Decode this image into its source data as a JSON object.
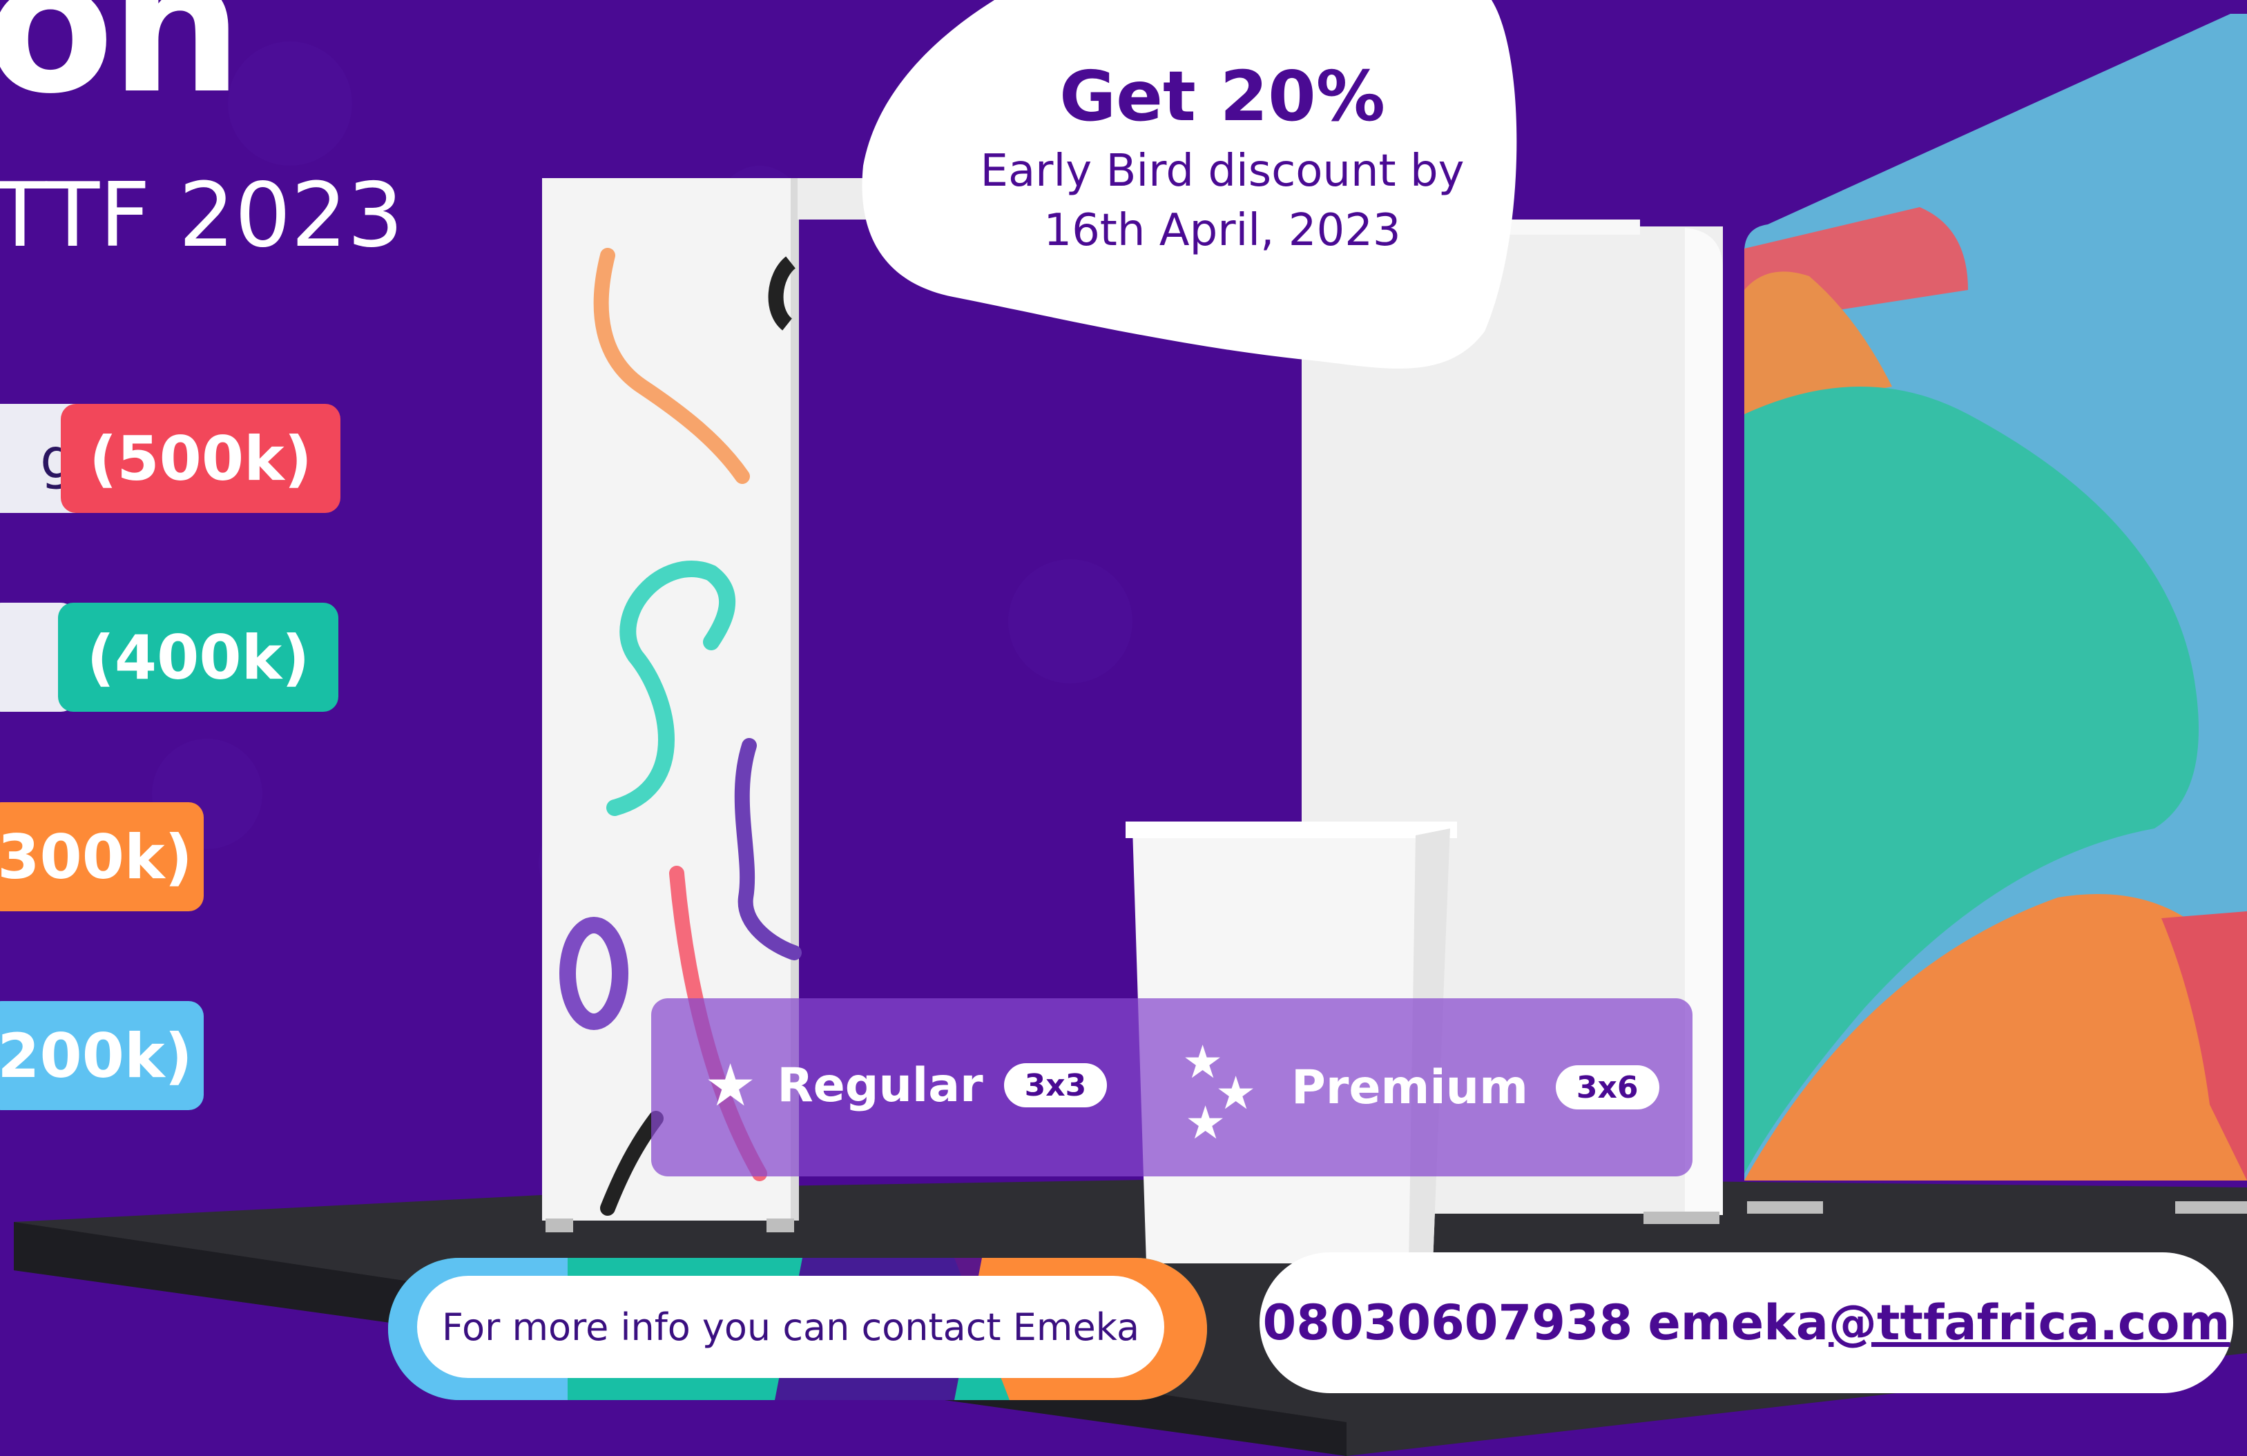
{
  "headline_fragment": "on",
  "subtitle": "TTF 2023",
  "pricing": {
    "prefix_fragment": "g)",
    "tiers": [
      {
        "label": "(500k)",
        "color": "#F2475A"
      },
      {
        "label": "(400k)",
        "color": "#18BFA5"
      },
      {
        "label": "300k)",
        "color": "#FD8A37"
      },
      {
        "label": "200k)",
        "color": "#5EC2F2"
      }
    ]
  },
  "promo": {
    "title": "Get 20%",
    "line1": "Early Bird discount by",
    "line2": "16th April, 2023"
  },
  "booth_types": [
    {
      "name": "Regular",
      "size": "3x3",
      "icon": "star-icon"
    },
    {
      "name": "Premium",
      "size": "3x6",
      "icon": "stars-icon"
    }
  ],
  "contact": {
    "prompt": "For more info you can contact Emeka",
    "phone": "08030607938",
    "email_user": "emeka",
    "email_domain": "@ttfafrica.com"
  },
  "colors": {
    "background": "#4A0A93",
    "accent_red": "#F2475A",
    "accent_teal": "#18BFA5",
    "accent_orange": "#FD8A37",
    "accent_blue": "#5EC2F2"
  }
}
